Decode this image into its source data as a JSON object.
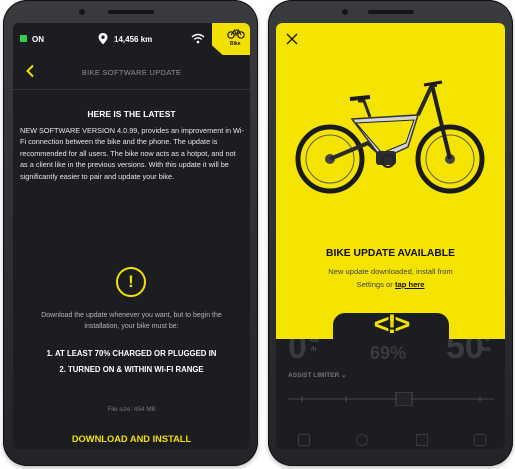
{
  "left_screen": {
    "status_bar": {
      "power_label": "ON",
      "odometer": "14,456 km",
      "bike_tab_label": "Bike"
    },
    "nav": {
      "title": "BIKE SOFTWARE UPDATE"
    },
    "heading": "HERE IS THE LATEST",
    "body": "NEW SOFTWARE VERSION 4.0.99, provides an improvement in Wi-Fi connection between the bike and the phone. The update is recommended for all users. The bike now acts as a hotpot, and not as a client like in the previous versions. With this update it will be significantly easier to pair and update your bike.",
    "download_note": "Download the update whenever you want, but to begin the installation, your bike must be:",
    "requirements": [
      "1. AT LEAST 70% CHARGED OR PLUGGED IN",
      "2. TURNED ON & WITHIN WI-FI RANGE"
    ],
    "file_size": "File size: 454 MB",
    "download_button": "DOWNLOAD AND INSTALL"
  },
  "right_screen": {
    "title": "BIKE UPDATE AVAILABLE",
    "message_line1": "New update downloaded, install from",
    "message_prefix": "Settings or",
    "tap_link": "tap here",
    "warning_glyph": "<!>",
    "dashboard": {
      "speed": "0",
      "speed_unit_top": "km",
      "speed_unit_bottom": "/h",
      "battery": "69%",
      "range": "50",
      "range_unit_top": "%",
      "range_unit_bottom": "km",
      "assist_label": "ASSIST LIMITER ⌄"
    }
  },
  "icons": [
    "power-indicator-icon",
    "location-pin-icon",
    "wifi-icon",
    "bike-icon",
    "back-chevron-icon",
    "alert-icon",
    "close-icon",
    "bike-illustration",
    "warning-icon"
  ],
  "colors": {
    "accent_yellow": "#F5E400",
    "screen_dark": "#1C1D21",
    "status_green": "#2ED14B"
  }
}
